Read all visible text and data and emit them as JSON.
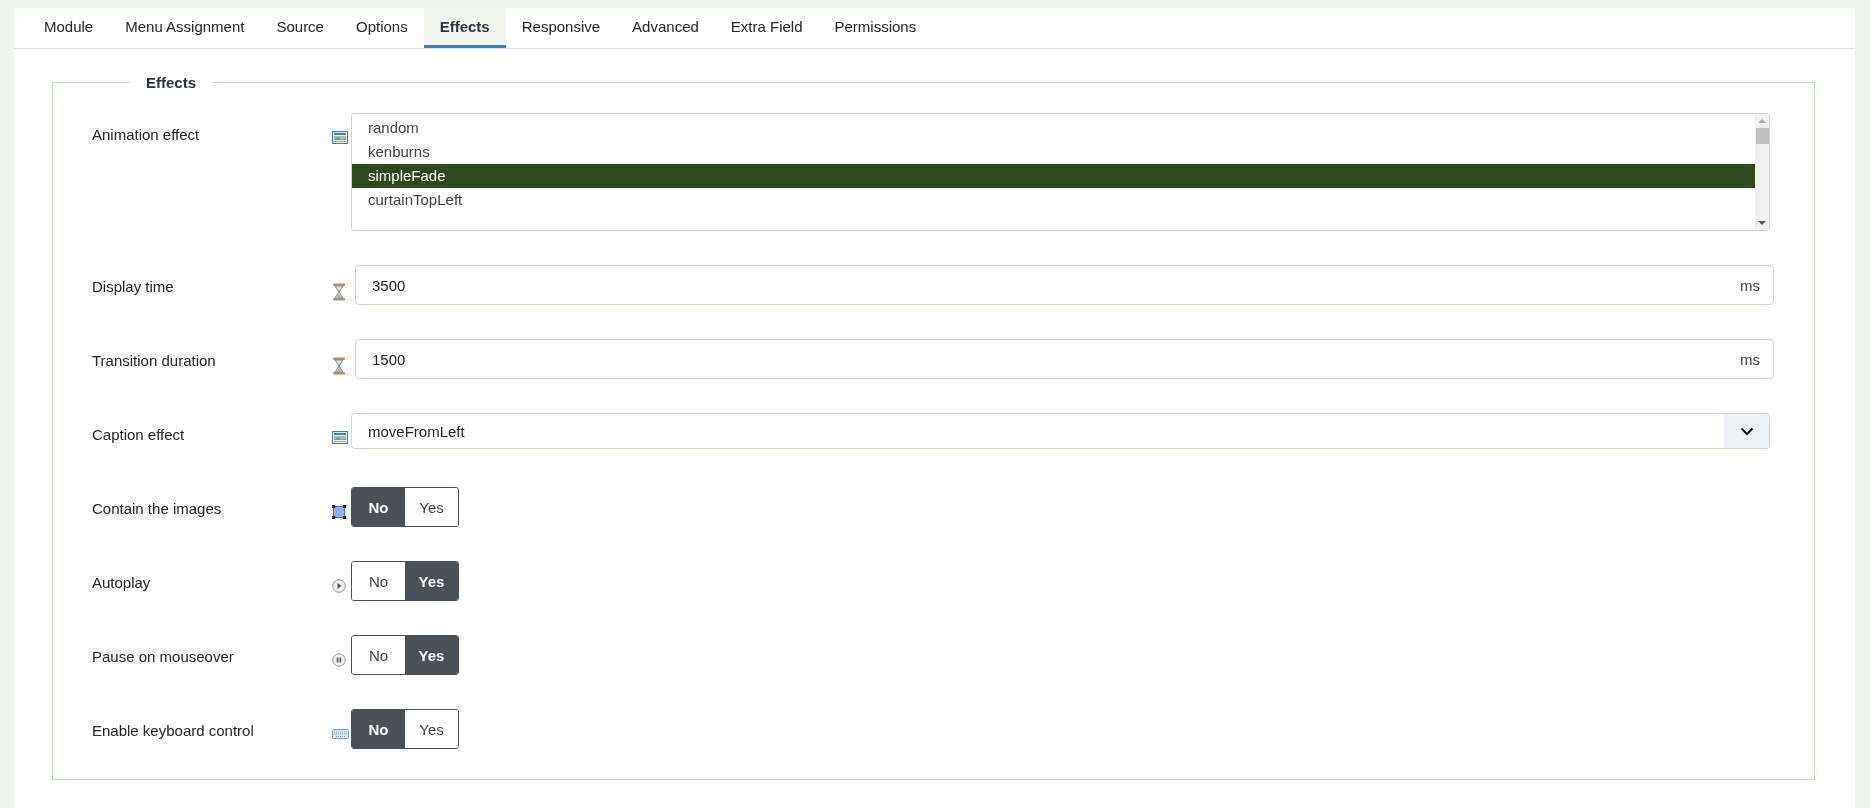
{
  "tabs": [
    {
      "label": "Module",
      "selected": false
    },
    {
      "label": "Menu Assignment",
      "selected": false
    },
    {
      "label": "Source",
      "selected": false
    },
    {
      "label": "Options",
      "selected": false
    },
    {
      "label": "Effects",
      "selected": true
    },
    {
      "label": "Responsive",
      "selected": false
    },
    {
      "label": "Advanced",
      "selected": false
    },
    {
      "label": "Extra Field",
      "selected": false
    },
    {
      "label": "Permissions",
      "selected": false
    }
  ],
  "fieldset": {
    "legend": "Effects",
    "fields": [
      {
        "kind": "listbox",
        "label": "Animation effect",
        "options": [
          {
            "label": "random",
            "selected": false
          },
          {
            "label": "kenburns",
            "selected": false
          },
          {
            "label": "simpleFade",
            "selected": true
          },
          {
            "label": "curtainTopLeft",
            "selected": false
          }
        ]
      },
      {
        "kind": "input",
        "label": "Display time",
        "value": "3500",
        "unit": "ms"
      },
      {
        "kind": "input",
        "label": "Transition duration",
        "value": "1500",
        "unit": "ms"
      },
      {
        "kind": "select",
        "label": "Caption effect",
        "value": "moveFromLeft"
      },
      {
        "kind": "toggle",
        "label": "Contain the images",
        "options": [
          {
            "label": "No",
            "selected": true
          },
          {
            "label": "Yes",
            "selected": false
          }
        ]
      },
      {
        "kind": "toggle",
        "label": "Autoplay",
        "options": [
          {
            "label": "No",
            "selected": false
          },
          {
            "label": "Yes",
            "selected": true
          }
        ]
      },
      {
        "kind": "toggle",
        "label": "Pause on mouseover",
        "options": [
          {
            "label": "No",
            "selected": false
          },
          {
            "label": "Yes",
            "selected": true
          }
        ]
      },
      {
        "kind": "toggle",
        "label": "Enable keyboard control",
        "options": [
          {
            "label": "No",
            "selected": true
          },
          {
            "label": "Yes",
            "selected": false
          }
        ]
      }
    ]
  }
}
